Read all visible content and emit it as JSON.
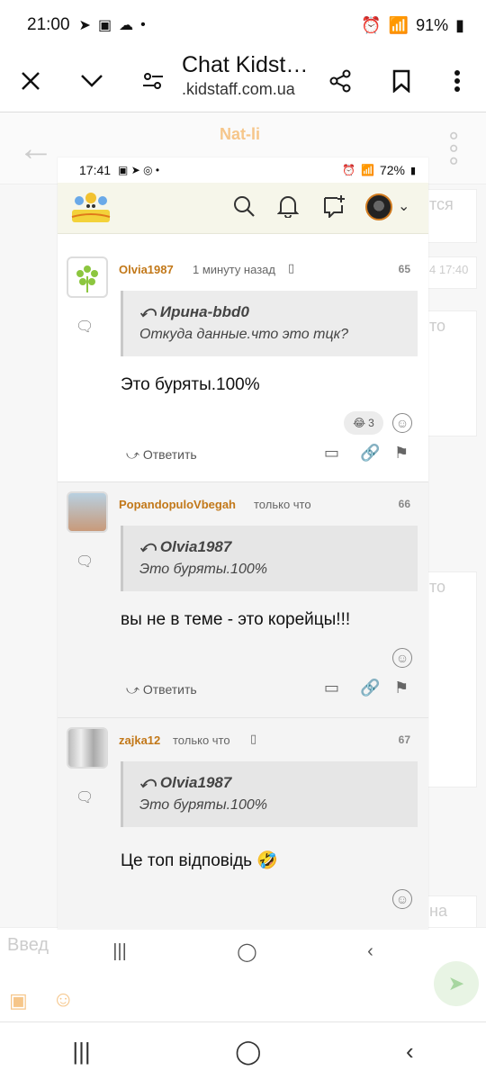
{
  "status": {
    "time": "21:00",
    "battery": "91%"
  },
  "tab": {
    "title": "Chat Kidst…",
    "url": ".kidstaff.com.ua"
  },
  "bg": {
    "name": "Nat-li",
    "snippets": [
      "тся",
      "4 17:40",
      "то",
      "то",
      "на"
    ],
    "input_placeholder": "Введ"
  },
  "inner": {
    "time": "17:41",
    "battery": "72%",
    "posts": [
      {
        "author": "Olvia1987",
        "meta": "1 минуту назад",
        "number": "65",
        "quote_author": "Ирина-bbd0",
        "quote_text": "Откуда данные.что это тцк?",
        "text": "Это буряты.100%",
        "reaction_count": "3",
        "reply_label": "Ответить"
      },
      {
        "author": "PopandopuloVbegah",
        "meta": "только что",
        "number": "66",
        "quote_author": "Olvia1987",
        "quote_text": "Это буряты.100%",
        "text": "вы не в теме - это корейцы!!!",
        "reply_label": "Ответить"
      },
      {
        "author": "zajka12",
        "meta": "только что",
        "number": "67",
        "quote_author": "Olvia1987",
        "quote_text": "Это буряты.100%",
        "text": "Це топ відповідь 🤣"
      }
    ]
  },
  "icons": {
    "close": "close-icon",
    "expand": "chevron-down-icon",
    "settings": "tune-icon",
    "share": "share-icon",
    "bookmark": "bookmark-icon",
    "more": "more-vert-icon"
  },
  "colors": {
    "accent": "#c27819",
    "nav_bg": "#f6f6ea"
  }
}
